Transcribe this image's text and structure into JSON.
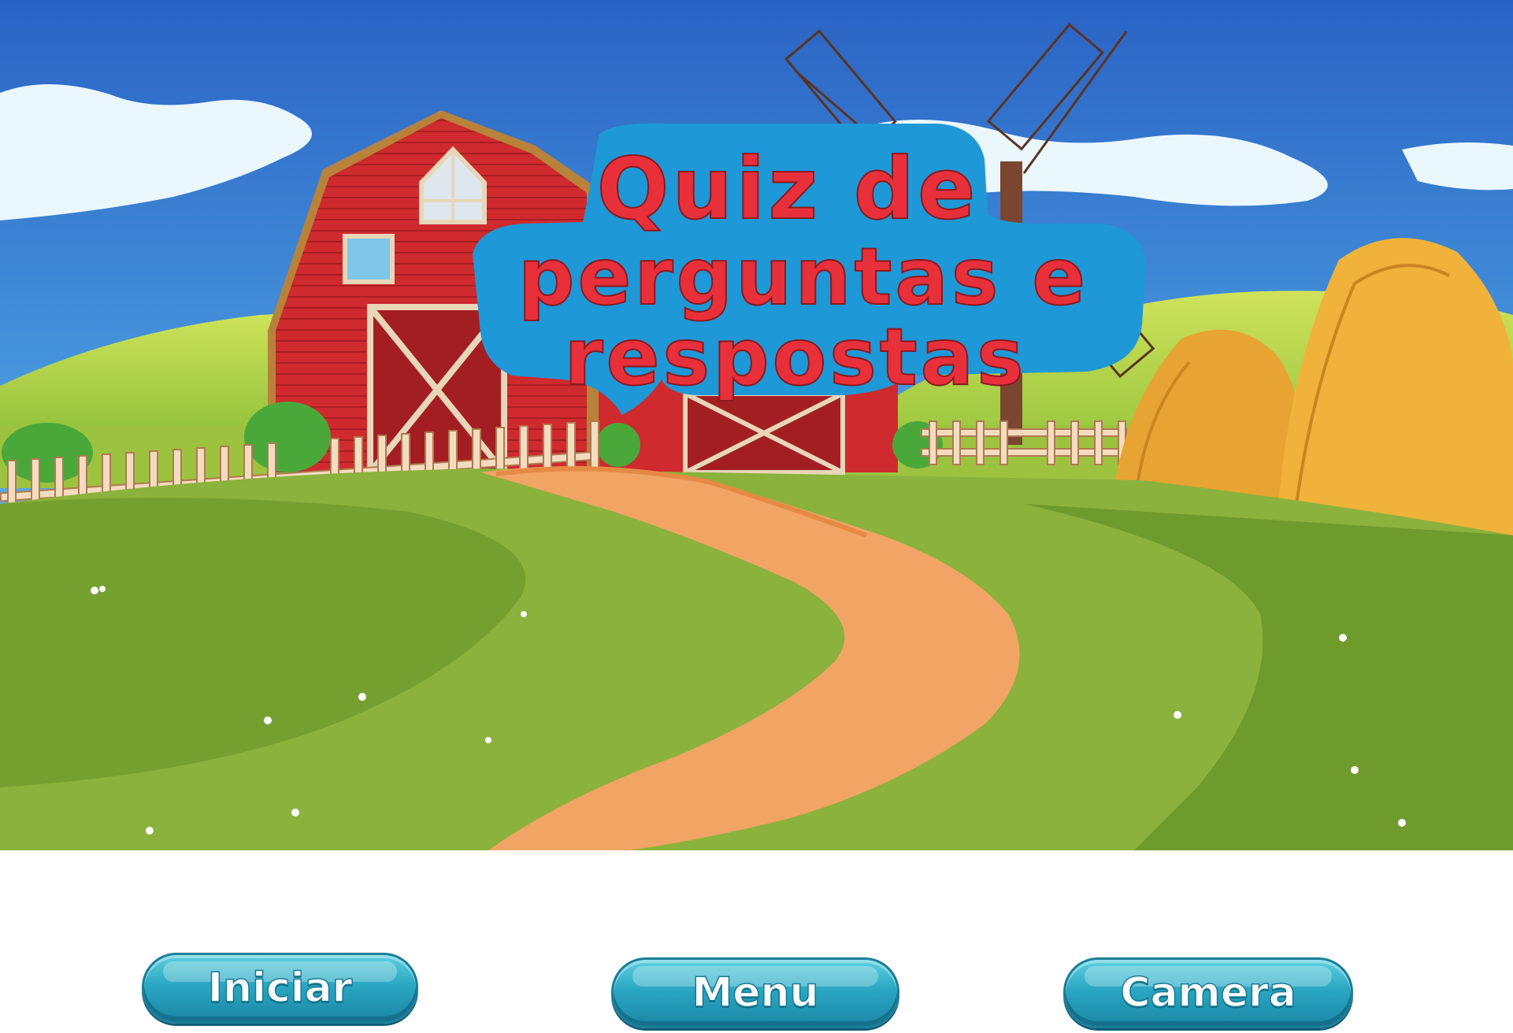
{
  "title": {
    "line1": "Quiz de",
    "line2": "perguntas e",
    "line3": "respostas"
  },
  "buttons": {
    "start_label": "Iniciar",
    "menu_label": "Menu",
    "camera_label": "Camera"
  },
  "colors": {
    "title_text": "#e8303a",
    "title_bubble": "#1e98d6",
    "button": "#2aa7c2",
    "sky": "#2f6fcc",
    "grass": "#8bb23c",
    "path": "#f2a465",
    "barn": "#c8262b",
    "hay": "#f0b23a"
  }
}
